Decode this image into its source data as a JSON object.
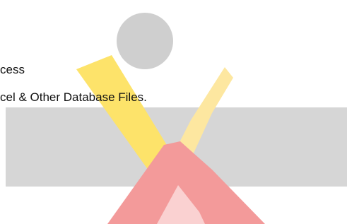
{
  "content": {
    "line1": "cess",
    "line2": "cel & Other Database Files."
  },
  "watermark": {
    "colors": {
      "circle": "#cfcfcf",
      "gray_block": "#d6d6d6",
      "yellow": "#fde36a",
      "red": "#f39a9a"
    }
  }
}
